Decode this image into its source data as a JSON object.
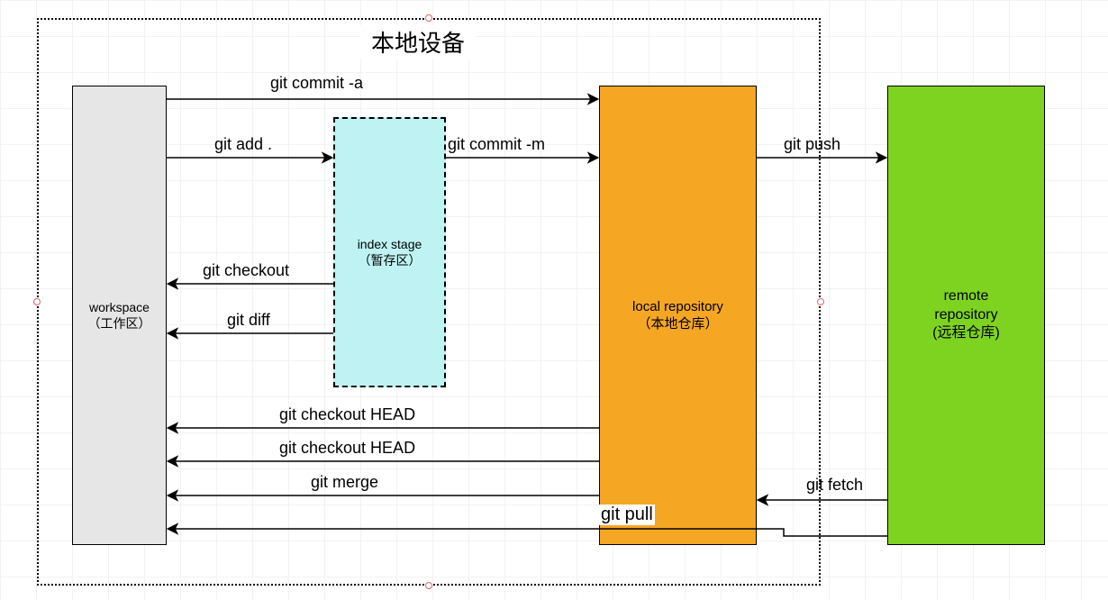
{
  "title": "本地设备",
  "boxes": {
    "workspace": {
      "line1": "workspace",
      "line2": "（工作区）"
    },
    "index": {
      "line1": "index stage",
      "line2": "（暂存区）"
    },
    "local": {
      "line1": "local repository",
      "line2": "（本地仓库）"
    },
    "remote": {
      "line1": "remote",
      "line2": "repository",
      "line3": "(远程仓库)"
    }
  },
  "arrows": {
    "commit_a": "git commit -a",
    "add": "git add .",
    "commit_m": "git commit -m",
    "push": "git push",
    "checkout": "git checkout",
    "diff": "git diff",
    "chk_head1": "git checkout HEAD",
    "chk_head2": "git checkout HEAD",
    "merge": "git merge",
    "fetch": "git fetch",
    "pull": "git pull"
  }
}
